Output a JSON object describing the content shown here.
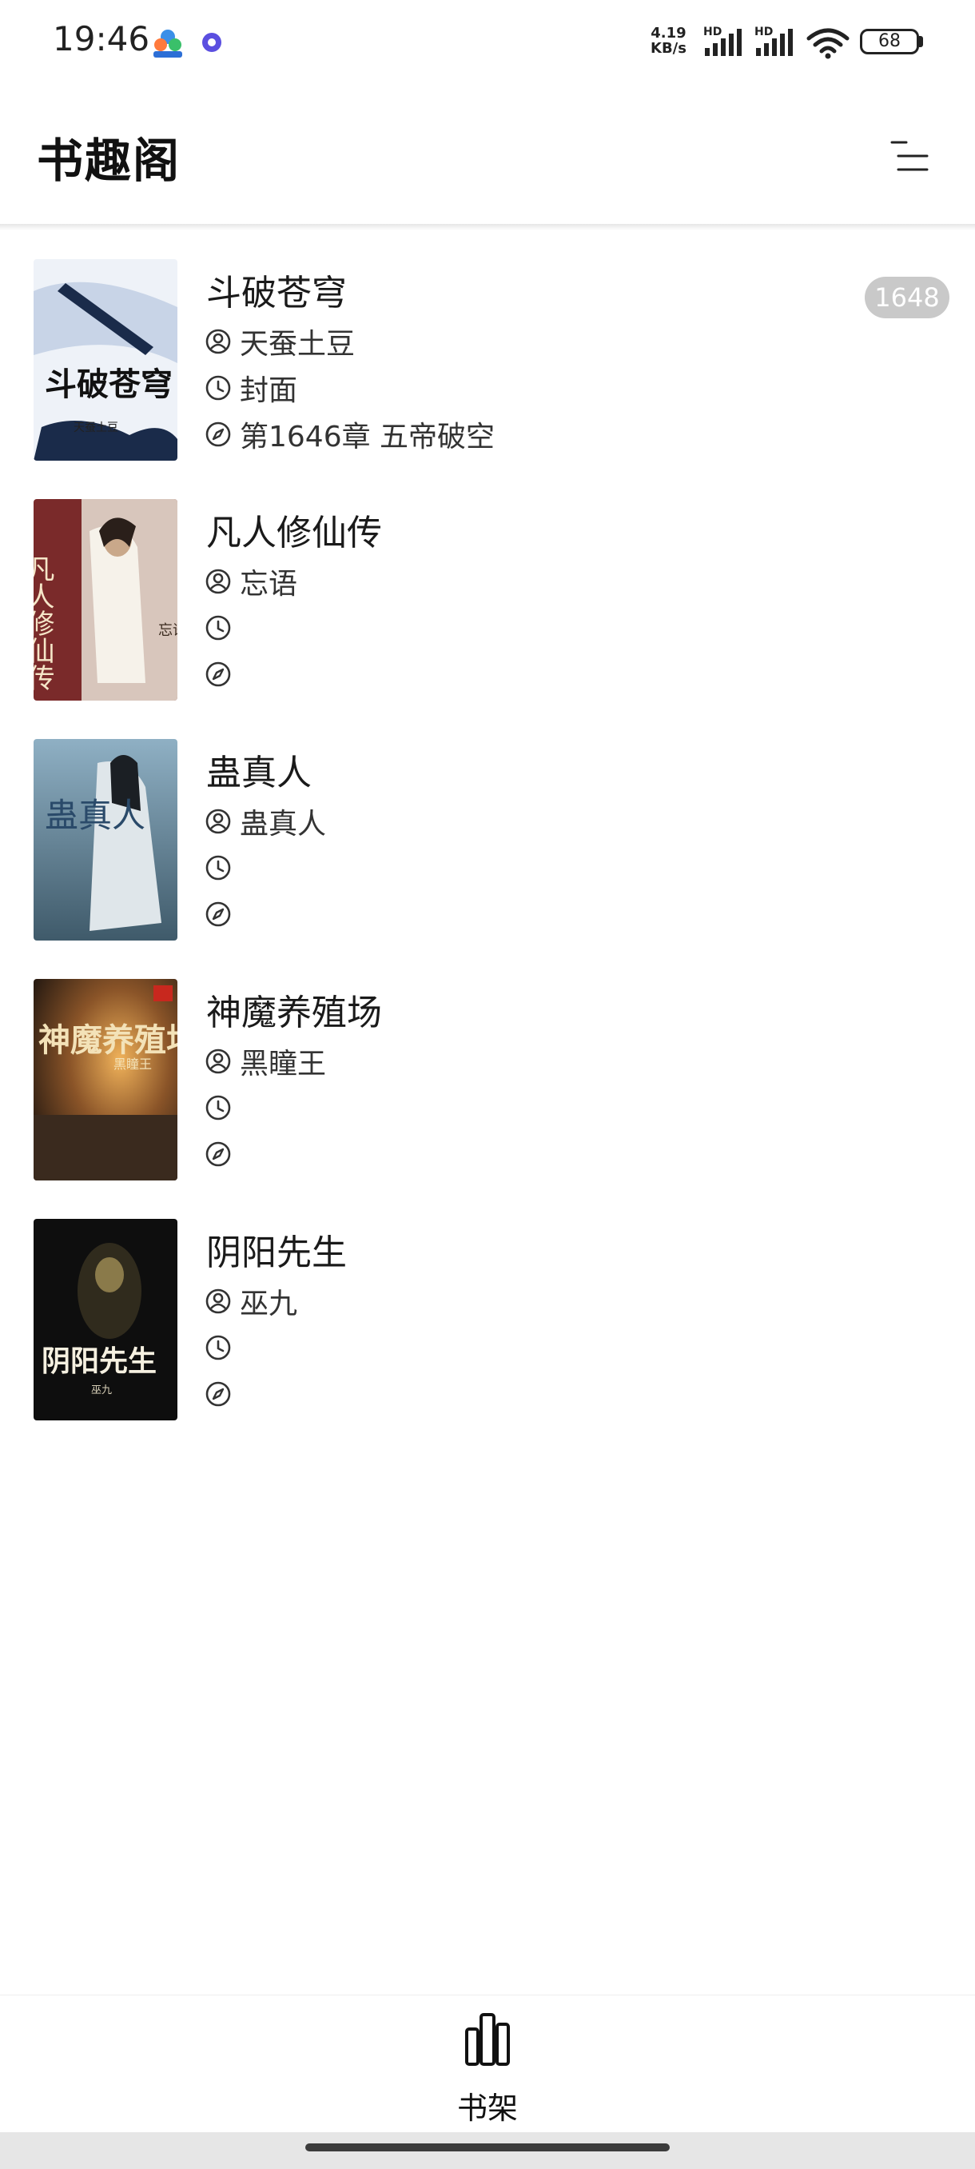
{
  "status_bar": {
    "time": "19:46",
    "network_speed_value": "4.19",
    "network_speed_unit": "KB/s",
    "signal_label_1": "HD",
    "signal_label_2": "HD",
    "battery": "68",
    "icons": [
      "app-notification-icon",
      "app-notification-icon-2",
      "signal-icon",
      "signal-icon",
      "wifi-icon",
      "battery-icon"
    ]
  },
  "header": {
    "title": "书趣阁",
    "menu_icon": "sort-menu-icon"
  },
  "books": [
    {
      "title": "斗破苍穹",
      "author": "天蚕土豆",
      "update": "封面",
      "latest": "第1646章 五帝破空",
      "badge": "1648",
      "cover_colors": [
        "#eef2f8",
        "#1a2b4a"
      ]
    },
    {
      "title": "凡人修仙传",
      "author": "忘语",
      "update": "",
      "latest": "",
      "badge": "",
      "cover_colors": [
        "#7a2a2a",
        "#e9e2d6"
      ]
    },
    {
      "title": "蛊真人",
      "author": "蛊真人",
      "update": "",
      "latest": "",
      "badge": "",
      "cover_colors": [
        "#5f7f93",
        "#dfe6ea"
      ]
    },
    {
      "title": "神魔养殖场",
      "author": "黑瞳王",
      "update": "",
      "latest": "",
      "badge": "",
      "cover_colors": [
        "#3a2a1e",
        "#e8a54a"
      ]
    },
    {
      "title": "阴阳先生",
      "author": "巫九",
      "update": "",
      "latest": "",
      "badge": "",
      "cover_colors": [
        "#0e0e0e",
        "#d8b86a"
      ]
    }
  ],
  "cover_text": [
    {
      "main": "斗破苍穹",
      "sub": "天蚕土豆"
    },
    {
      "main": "凡人修仙传",
      "sub": "忘语"
    },
    {
      "main": "蛊真人",
      "sub": ""
    },
    {
      "main": "神魔养殖场",
      "sub": "黑瞳王"
    },
    {
      "main": "阴阳先生",
      "sub": "巫九"
    }
  ],
  "row_icons": [
    "author-icon",
    "clock-icon",
    "compass-icon"
  ],
  "bottom_nav": {
    "shelf_label": "书架",
    "shelf_icon": "bookshelf-icon"
  }
}
